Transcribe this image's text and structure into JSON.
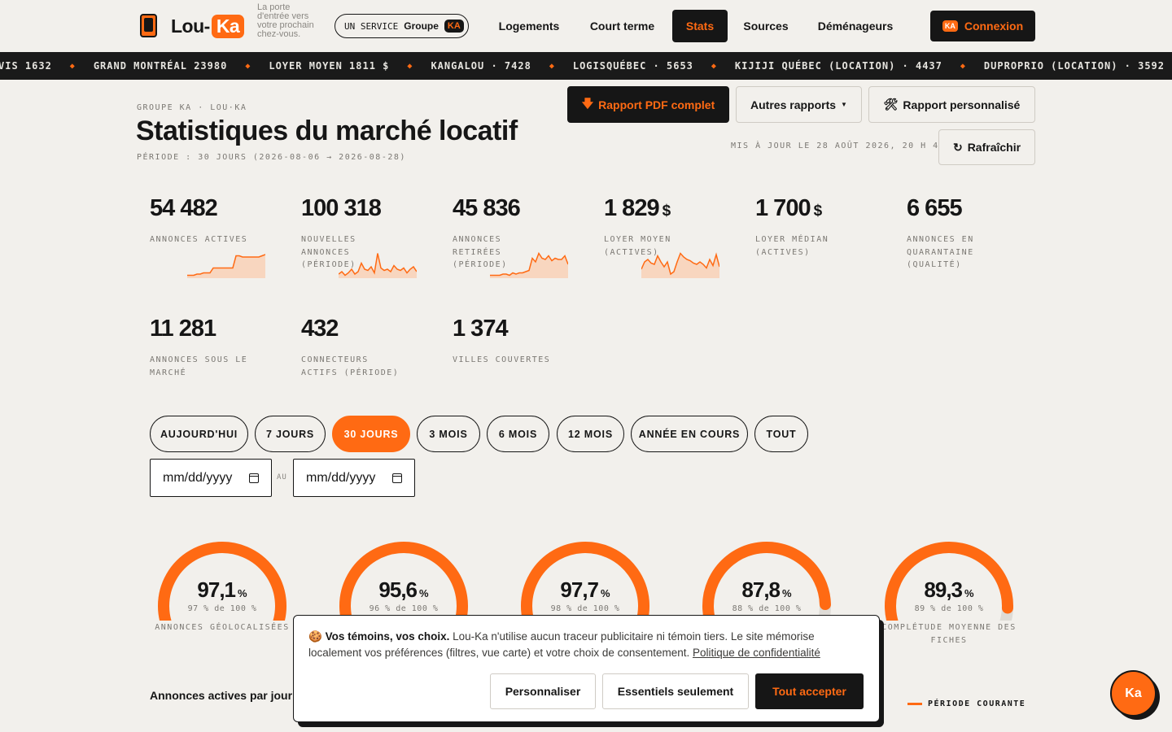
{
  "brand": {
    "name_part1": "Lou-",
    "name_part2": "Ka",
    "tagline": "La porte d'entrée vers votre prochain chez-vous."
  },
  "service": {
    "prefix": "UN SERVICE",
    "group": "Groupe",
    "group_mark": "KA"
  },
  "nav": [
    {
      "label": "Logements",
      "active": false
    },
    {
      "label": "Court terme",
      "active": false
    },
    {
      "label": "Stats",
      "active": true
    },
    {
      "label": "Sources",
      "active": false
    },
    {
      "label": "Déménageurs",
      "active": false
    }
  ],
  "login": {
    "icon_text": "KA",
    "label": "Connexion"
  },
  "ticker": [
    "VIS 1632",
    "GRAND MONTRÉAL 23980",
    "LOYER MOYEN 1811 $",
    "KANGALOU · 7428",
    "LOGISQUÉBEC · 5653",
    "KIJIJI QUÉBEC (LOCATION) · 4437",
    "DUPROPRIO (LOCATION) · 3592"
  ],
  "page": {
    "kicker": "GROUPE KA · LOU·KA",
    "title": "Statistiques du marché locatif",
    "period": "PÉRIODE : 30 JOURS (2026-08-06 → 2026-08-28)",
    "updated": "MIS À JOUR LE 28 AOÛT 2026, 20 H 49"
  },
  "actions": {
    "pdf": "Rapport PDF complet",
    "other": "Autres rapports",
    "custom": "Rapport personnalisé",
    "refresh": "Rafraîchir"
  },
  "stats": [
    {
      "value": "54 482",
      "unit": "",
      "label": "ANNONCES ACTIVES",
      "spark": [
        0.05,
        0.05,
        0.05,
        0.1,
        0.1,
        0.15,
        0.15,
        0.15,
        0.35,
        0.35,
        0.35,
        0.35,
        0.35,
        0.35,
        0.35,
        0.85,
        0.85,
        0.8,
        0.8,
        0.8,
        0.8,
        0.8,
        0.8,
        0.85,
        0.9
      ]
    },
    {
      "value": "100 318",
      "unit": "",
      "label": "NOUVELLES ANNONCES (PÉRIODE)",
      "spark": [
        0.1,
        0.2,
        0.05,
        0.15,
        0.3,
        0.1,
        0.2,
        0.55,
        0.3,
        0.25,
        0.4,
        0.15,
        0.95,
        0.35,
        0.25,
        0.3,
        0.2,
        0.45,
        0.3,
        0.25,
        0.35,
        0.15,
        0.3,
        0.4,
        0.2
      ]
    },
    {
      "value": "45 836",
      "unit": "",
      "label": "ANNONCES RETIRÉES (PÉRIODE)",
      "spark": [
        0.05,
        0.05,
        0.05,
        0.05,
        0.1,
        0.1,
        0.05,
        0.15,
        0.1,
        0.15,
        0.15,
        0.2,
        0.25,
        0.75,
        0.6,
        0.95,
        0.75,
        0.7,
        0.85,
        0.65,
        0.75,
        0.7,
        0.7,
        0.85,
        0.5
      ]
    },
    {
      "value": "1 829",
      "unit": "$",
      "label": "LOYER MOYEN (ACTIVES)",
      "spark": [
        0.3,
        0.6,
        0.7,
        0.55,
        0.5,
        0.85,
        0.6,
        0.4,
        0.6,
        0.1,
        0.2,
        0.6,
        0.95,
        0.8,
        0.7,
        0.65,
        0.55,
        0.5,
        0.6,
        0.5,
        0.35,
        0.7,
        0.45,
        0.9,
        0.4
      ]
    },
    {
      "value": "1 700",
      "unit": "$",
      "label": "LOYER MÉDIAN (ACTIVES)",
      "spark": []
    },
    {
      "value": "6 655",
      "unit": "",
      "label": "ANNONCES EN QUARANTAINE (QUALITÉ)",
      "spark": []
    },
    {
      "value": "11 281",
      "unit": "",
      "label": "ANNONCES SOUS LE MARCHÉ",
      "spark": []
    },
    {
      "value": "432",
      "unit": "",
      "label": "CONNECTEURS ACTIFS (PÉRIODE)",
      "spark": []
    },
    {
      "value": "1 374",
      "unit": "",
      "label": "VILLES COUVERTES",
      "spark": []
    }
  ],
  "periods": [
    {
      "label": "AUJOURD'HUI",
      "active": false
    },
    {
      "label": "7 JOURS",
      "active": false
    },
    {
      "label": "30 JOURS",
      "active": true
    },
    {
      "label": "3 MOIS",
      "active": false
    },
    {
      "label": "6 MOIS",
      "active": false
    },
    {
      "label": "12 MOIS",
      "active": false
    },
    {
      "label": "ANNÉE EN COURS",
      "active": false
    },
    {
      "label": "TOUT",
      "active": false
    }
  ],
  "date_range": {
    "from": "mm/dd/yyyy",
    "sep": "AU",
    "to": "mm/dd/yyyy"
  },
  "gauges": [
    {
      "value": "97,1",
      "pct": 97.1,
      "sub": "97 % de 100 %",
      "label": "ANNONCES GÉOLOCALISÉES"
    },
    {
      "value": "95,6",
      "pct": 95.6,
      "sub": "96 % de 100 %",
      "label": ""
    },
    {
      "value": "97,7",
      "pct": 97.7,
      "sub": "98 % de 100 %",
      "label": ""
    },
    {
      "value": "87,8",
      "pct": 87.8,
      "sub": "88 % de 100 %",
      "label": ""
    },
    {
      "value": "89,3",
      "pct": 89.3,
      "sub": "89 % de 100 %",
      "label": "COMPLÉTUDE MOYENNE DES FICHES"
    }
  ],
  "gauge_unit": "%",
  "section": {
    "title": "Annonces actives par jour",
    "legend": "PÉRIODE COURANTE"
  },
  "cookie": {
    "emoji": "🍪",
    "title": "Vos témoins, vos choix.",
    "text": " Lou-Ka n'utilise aucun traceur publicitaire ni témoin tiers. Le site mémorise localement vos préférences (filtres, vue carte) et votre choix de consentement. ",
    "link": "Politique de confidentialité",
    "customize": "Personnaliser",
    "essentials": "Essentiels seulement",
    "accept": "Tout accepter"
  },
  "fab": "Ka",
  "colors": {
    "accent": "#ff6a13",
    "dark": "#161616",
    "background": "#f2f0ec",
    "muted": "#7b7873"
  }
}
